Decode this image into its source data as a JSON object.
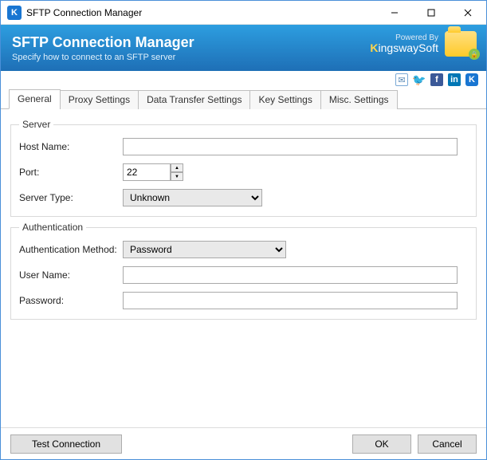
{
  "window": {
    "title": "SFTP Connection Manager"
  },
  "banner": {
    "title": "SFTP Connection Manager",
    "subtitle": "Specify how to connect to an SFTP server",
    "powered_by": "Powered By",
    "brand": "KingswaySoft"
  },
  "social": {
    "envelope": "✉",
    "twitter": "🐦",
    "facebook": "f",
    "linkedin": "in",
    "k": "K"
  },
  "tabs": [
    {
      "label": "General",
      "active": true
    },
    {
      "label": "Proxy Settings"
    },
    {
      "label": "Data Transfer Settings"
    },
    {
      "label": "Key Settings"
    },
    {
      "label": "Misc. Settings"
    }
  ],
  "server_group": {
    "legend": "Server",
    "host_label": "Host Name:",
    "host_value": "",
    "port_label": "Port:",
    "port_value": "22",
    "type_label": "Server Type:",
    "type_value": "Unknown"
  },
  "auth_group": {
    "legend": "Authentication",
    "method_label": "Authentication Method:",
    "method_value": "Password",
    "user_label": "User Name:",
    "user_value": "",
    "pass_label": "Password:",
    "pass_value": ""
  },
  "footer": {
    "test": "Test Connection",
    "ok": "OK",
    "cancel": "Cancel"
  }
}
